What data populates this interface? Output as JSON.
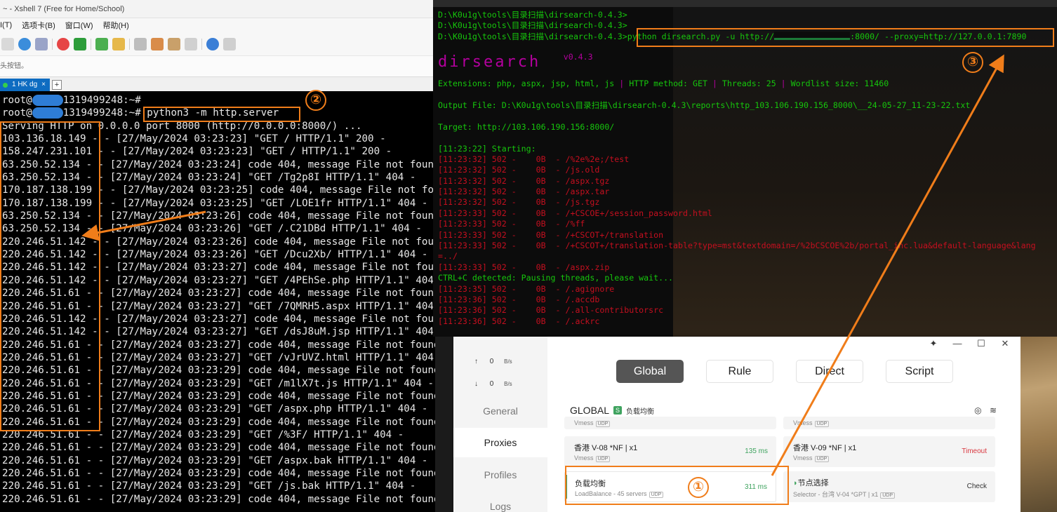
{
  "xshell": {
    "title": "~ - Xshell 7 (Free for Home/School)",
    "menu": [
      "I(T)",
      "选项卡(B)",
      "窗口(W)",
      "帮助(H)"
    ],
    "address_hint": "头按钮。",
    "tab_label": "1 HK dg",
    "tab_close": "×",
    "tab_add": "+",
    "terminal": [
      {
        "prompt": "root@",
        "host_tail": "1319499248:~#",
        "cmd": ""
      },
      {
        "prompt": "root@",
        "host_tail": "1319499248:~#",
        "cmd": " python3 -m http.server"
      }
    ],
    "log_lines": [
      "Serving HTTP on 0.0.0.0 port 8000 (http://0.0.0.0:8000/) ...",
      "103.136.18.149 - - [27/May/2024 03:23:23] \"GET / HTTP/1.1\" 200 -",
      "158.247.231.101 - - [27/May/2024 03:23:23] \"GET / HTTP/1.1\" 200 -",
      "63.250.52.134 - - [27/May/2024 03:23:24] code 404, message File not found",
      "63.250.52.134 - - [27/May/2024 03:23:24] \"GET /Tg2p8I HTTP/1.1\" 404 -",
      "170.187.138.199 - - [27/May/2024 03:23:25] code 404, message File not found",
      "170.187.138.199 - - [27/May/2024 03:23:25] \"GET /LOE1fr HTTP/1.1\" 404 -",
      "63.250.52.134 - - [27/May/2024 03:23:26] code 404, message File not found",
      "63.250.52.134 - - [27/May/2024 03:23:26] \"GET /.C21DBd HTTP/1.1\" 404 -",
      "220.246.51.142 - - [27/May/2024 03:23:26] code 404, message File not found",
      "220.246.51.142 - - [27/May/2024 03:23:26] \"GET /Dcu2Xb/ HTTP/1.1\" 404 -",
      "220.246.51.142 - - [27/May/2024 03:23:27] code 404, message File not found",
      "220.246.51.142 - - [27/May/2024 03:23:27] \"GET /4PEhSe.php HTTP/1.1\" 404 -",
      "220.246.51.61 - - [27/May/2024 03:23:27] code 404, message File not found",
      "220.246.51.61 - - [27/May/2024 03:23:27] \"GET /7QMRH5.aspx HTTP/1.1\" 404 -",
      "220.246.51.142 - - [27/May/2024 03:23:27] code 404, message File not found",
      "220.246.51.142 - - [27/May/2024 03:23:27] \"GET /dsJ8uM.jsp HTTP/1.1\" 404 -",
      "220.246.51.61 - - [27/May/2024 03:23:27] code 404, message File not found",
      "220.246.51.61 - - [27/May/2024 03:23:27] \"GET /vJrUVZ.html HTTP/1.1\" 404 -",
      "220.246.51.61 - - [27/May/2024 03:23:29] code 404, message File not found",
      "220.246.51.61 - - [27/May/2024 03:23:29] \"GET /m1lX7t.js HTTP/1.1\" 404 -",
      "220.246.51.61 - - [27/May/2024 03:23:29] code 404, message File not found",
      "220.246.51.61 - - [27/May/2024 03:23:29] \"GET /aspx.php HTTP/1.1\" 404 -",
      "220.246.51.61 - - [27/May/2024 03:23:29] code 404, message File not found",
      "220.246.51.61 - - [27/May/2024 03:23:29] \"GET /%3F/ HTTP/1.1\" 404 -",
      "220.246.51.61 - - [27/May/2024 03:23:29] code 404, message File not found",
      "220.246.51.61 - - [27/May/2024 03:23:29] \"GET /aspx.bak HTTP/1.1\" 404 -",
      "220.246.51.61 - - [27/May/2024 03:23:29] code 404, message File not found",
      "220.246.51.61 - - [27/May/2024 03:23:29] \"GET /js.bak HTTP/1.1\" 404 -",
      "220.246.51.61 - - [27/May/2024 03:23:29] code 404, message File not found"
    ]
  },
  "cmd": {
    "prompt_lines": [
      "D:\\K0u1g\\tools\\目录扫描\\dirsearch-0.4.3>",
      "D:\\K0u1g\\tools\\目录扫描\\dirsearch-0.4.3>"
    ],
    "run_prompt": "D:\\K0u1g\\tools\\目录扫描\\dirsearch-0.4.3>",
    "run_cmd_a": "python dirsearch.py -u http://",
    "run_cmd_b": ":8000/ --proxy=http://127.0.0.1:7890",
    "logo": "dirsearch",
    "version": "v0.4.3",
    "extensions": {
      "k1": "Extensions: ",
      "v1": "php, aspx, jsp, html, js",
      "k2": "HTTP method: ",
      "v2": "GET",
      "k3": "Threads: ",
      "v3": "25",
      "k4": "Wordlist size: ",
      "v4": "11460"
    },
    "output_label": "Output File: ",
    "output_path": "D:\\K0u1g\\tools\\目录扫描\\dirsearch-0.4.3\\reports\\http_103.106.190.156_8000\\__24-05-27_11-23-22.txt",
    "target_label": "Target: ",
    "target_url": "http://103.106.190.156:8000/",
    "starting": "[11:23:22] Starting:",
    "results": [
      "[11:23:32] 502 -    0B  - /%2e%2e;/test",
      "[11:23:32] 502 -    0B  - /js.old",
      "[11:23:32] 502 -    0B  - /aspx.tgz",
      "[11:23:32] 502 -    0B  - /aspx.tar",
      "[11:23:32] 502 -    0B  - /js.tgz",
      "[11:23:33] 502 -    0B  - /+CSCOE+/session_password.html",
      "[11:23:33] 502 -    0B  - /%ff",
      "[11:23:33] 502 -    0B  - /+CSCOT+/translation",
      "[11:23:33] 502 -    0B  - /+CSCOT+/translation-table?type=mst&textdomain=/%2bCSCOE%2b/portal_inc.lua&default-language&lang",
      "=../",
      "[11:23:33] 502 -    0B  - /aspx.zip"
    ],
    "ctrl_c": "CTRL+C detected: Pausing threads, please wait...",
    "results2": [
      "[11:23:35] 502 -    0B  - /.agignore",
      "[11:23:36] 502 -    0B  - /.accdb",
      "[11:23:36] 502 -    0B  - /.all-contributorsrc",
      "[11:23:36] 502 -    0B  - /.ackrc"
    ]
  },
  "clash": {
    "upload_arrow": "↑",
    "upload_val": "0",
    "upload_unit": "B/s",
    "download_arrow": "↓",
    "download_val": "0",
    "download_unit": "B/s",
    "nav": [
      "General",
      "Proxies",
      "Profiles",
      "Logs"
    ],
    "modes": [
      "Global",
      "Rule",
      "Direct",
      "Script"
    ],
    "group_name": "GLOBAL",
    "group_badge": "S",
    "group_sub": "负载均衡",
    "cards": [
      {
        "name": "Vmess",
        "sub": "UDP",
        "lat": ""
      },
      {
        "name": "Vmess",
        "sub": "UDP",
        "lat": ""
      },
      {
        "name": "香港 V-08 *NF | x1",
        "sub": "Vmess",
        "lat": "135 ms"
      },
      {
        "name": "香港 V-09 *NF | x1",
        "sub": "Vmess",
        "lat": "Timeout"
      },
      {
        "name": "负载均衡",
        "sub": "LoadBalance - 45 servers",
        "lat": "311 ms"
      },
      {
        "name": "节点选择",
        "sub": "Selector - 台湾 V-04 *GPT | x1",
        "lat": "Check"
      }
    ],
    "udp_tag": "UDP",
    "colors": {
      "green": "#3fa35f",
      "red": "#d9363e"
    }
  },
  "annotations": {
    "one": "①",
    "two": "②",
    "three": "③",
    "color": "#f07d1a"
  }
}
